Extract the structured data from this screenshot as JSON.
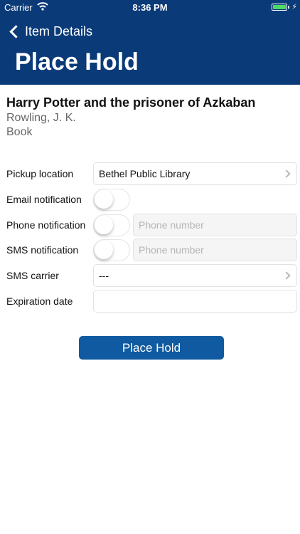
{
  "status_bar": {
    "carrier": "Carrier",
    "time": "8:36 PM"
  },
  "nav": {
    "back_label": "Item Details",
    "title": "Place Hold"
  },
  "item": {
    "title": "Harry Potter and the prisoner of Azkaban",
    "author": "Rowling, J. K.",
    "format": "Book"
  },
  "form": {
    "pickup_location": {
      "label": "Pickup location",
      "value": "Bethel Public Library"
    },
    "email_notification": {
      "label": "Email notification",
      "enabled": false
    },
    "phone_notification": {
      "label": "Phone notification",
      "enabled": false,
      "placeholder": "Phone number"
    },
    "sms_notification": {
      "label": "SMS notification",
      "enabled": false,
      "placeholder": "Phone number"
    },
    "sms_carrier": {
      "label": "SMS carrier",
      "value": "---"
    },
    "expiration_date": {
      "label": "Expiration date",
      "value": ""
    }
  },
  "actions": {
    "place_hold_label": "Place Hold"
  },
  "colors": {
    "header_bg": "#0a3a78",
    "button_bg": "#0f5aa0",
    "battery": "#4cd964"
  }
}
